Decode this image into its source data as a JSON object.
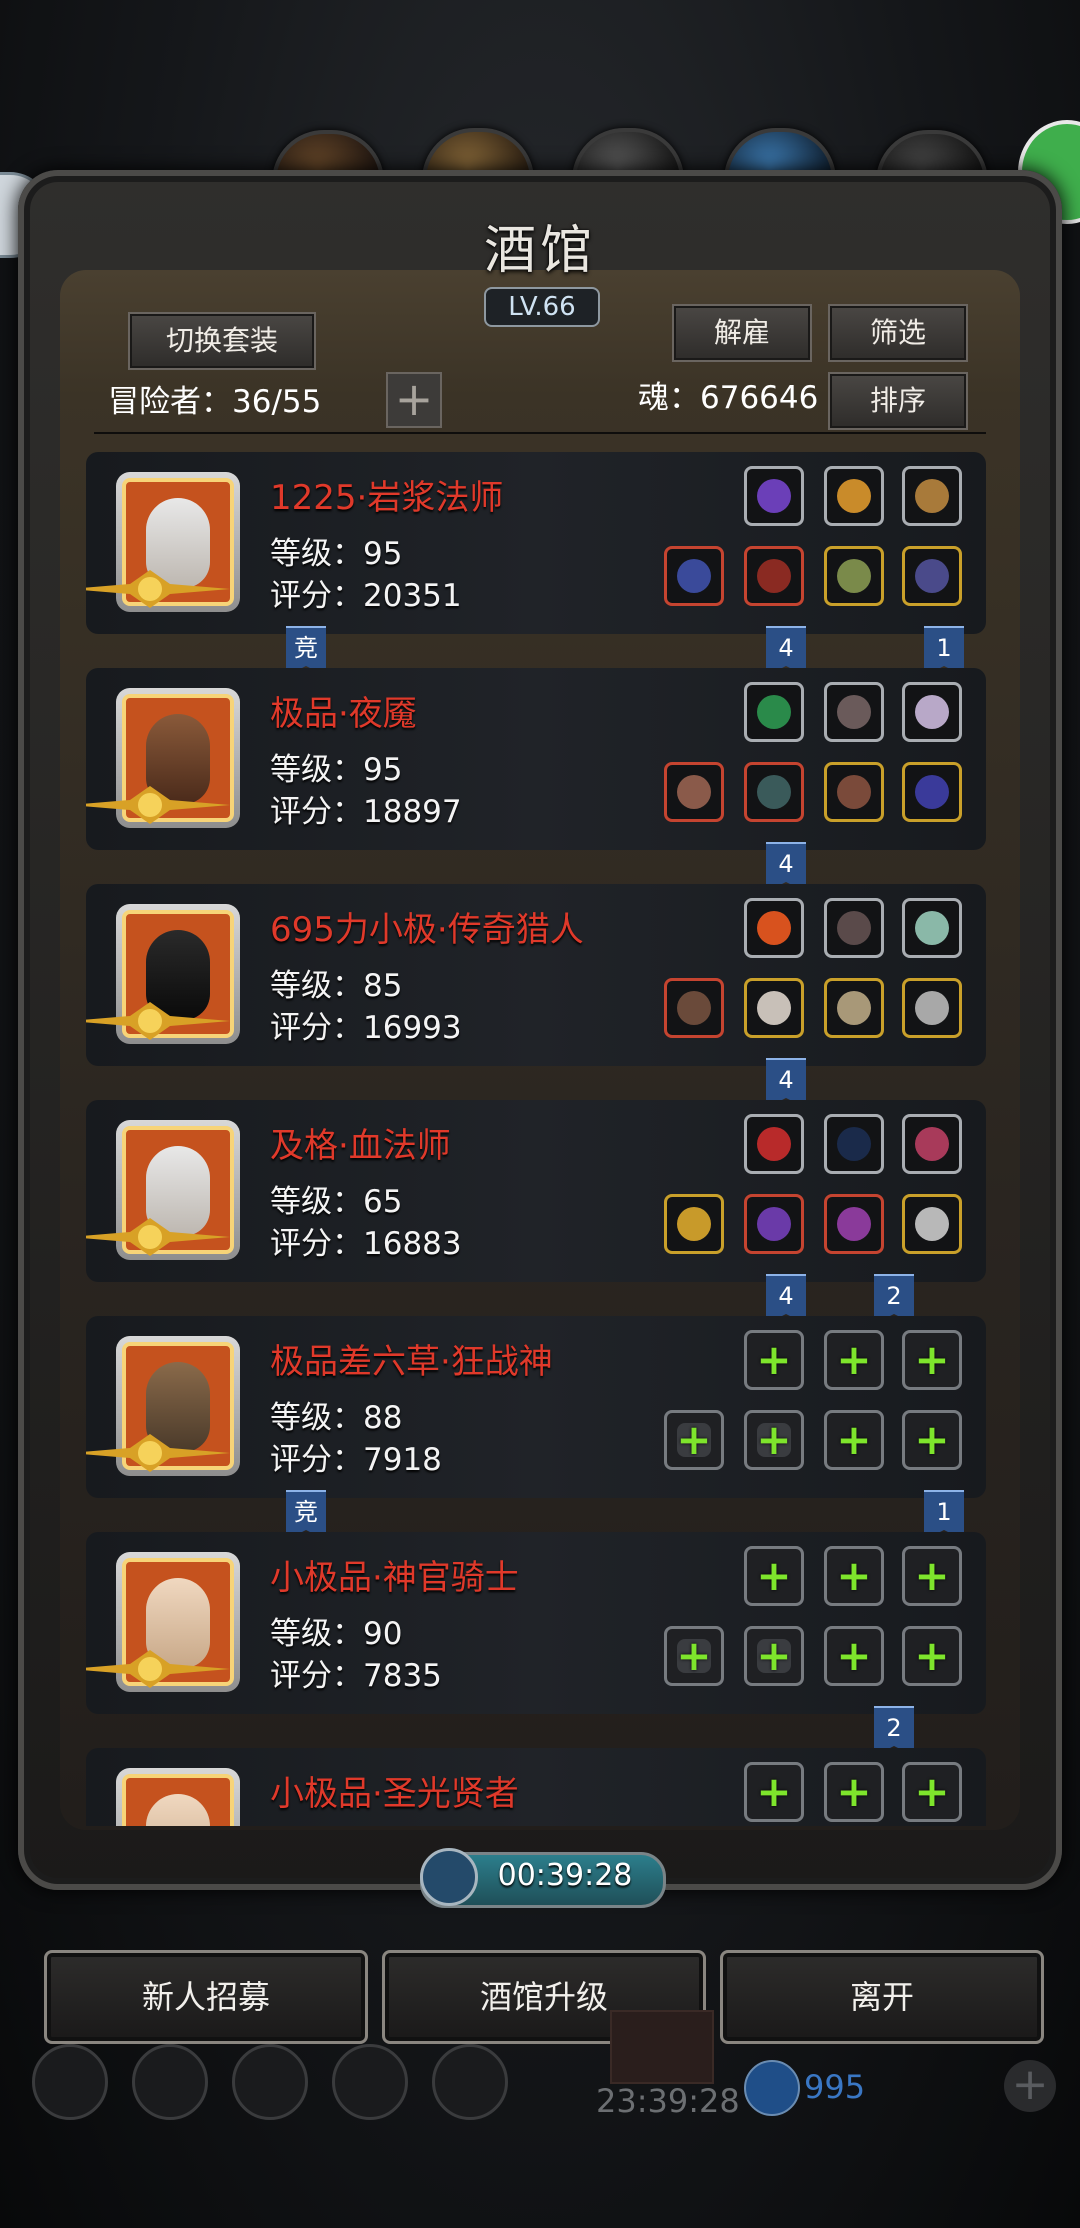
{
  "window": {
    "title": "酒馆",
    "level": "LV.66"
  },
  "toolbar": {
    "switch_suit": "切换套装",
    "dismiss": "解雇",
    "filter": "筛选",
    "sort": "排序",
    "add_symbol": "+"
  },
  "stats": {
    "adventurers": "冒险者：36/55",
    "soul": "魂：676646"
  },
  "heroes": [
    {
      "name": "1225·岩浆法师",
      "level": "等级：95",
      "score": "评分：20351",
      "top_tag": "",
      "bottom_tags": {
        "left": "竞",
        "mid": "4",
        "right": "1"
      }
    },
    {
      "name": "极品·夜魇",
      "level": "等级：95",
      "score": "评分：18897",
      "bottom_tags": {
        "left": "",
        "mid": "4",
        "right": ""
      }
    },
    {
      "name": "695力小极·传奇猎人",
      "level": "等级：85",
      "score": "评分：16993",
      "bottom_tags": {
        "left": "",
        "mid": "4",
        "right": ""
      }
    },
    {
      "name": "及格·血法师",
      "level": "等级：65",
      "score": "评分：16883",
      "bottom_tags": {
        "left": "",
        "mid": "4",
        "right2": "2"
      }
    },
    {
      "name": "极品差六草·狂战神",
      "level": "等级：88",
      "score": "评分：7918",
      "bottom_tags": {
        "left": "竞",
        "mid": "",
        "right": "1"
      }
    },
    {
      "name": "小极品·神官骑士",
      "level": "等级：90",
      "score": "评分：7835",
      "bottom_tags": {
        "left": "",
        "mid": "",
        "right2": "2"
      }
    },
    {
      "name": "小极品·圣光贤者",
      "level": "",
      "score": ""
    }
  ],
  "timer": "00:39:28",
  "actions": {
    "recruit": "新人招募",
    "upgrade": "酒馆升级",
    "leave": "离开"
  },
  "dock": {
    "time": "23:39:28",
    "gems": "995"
  },
  "colors": {
    "hero_name": "#e0392a",
    "add_plus": "#7ee52c",
    "tag_blue": "#2b4f86"
  }
}
